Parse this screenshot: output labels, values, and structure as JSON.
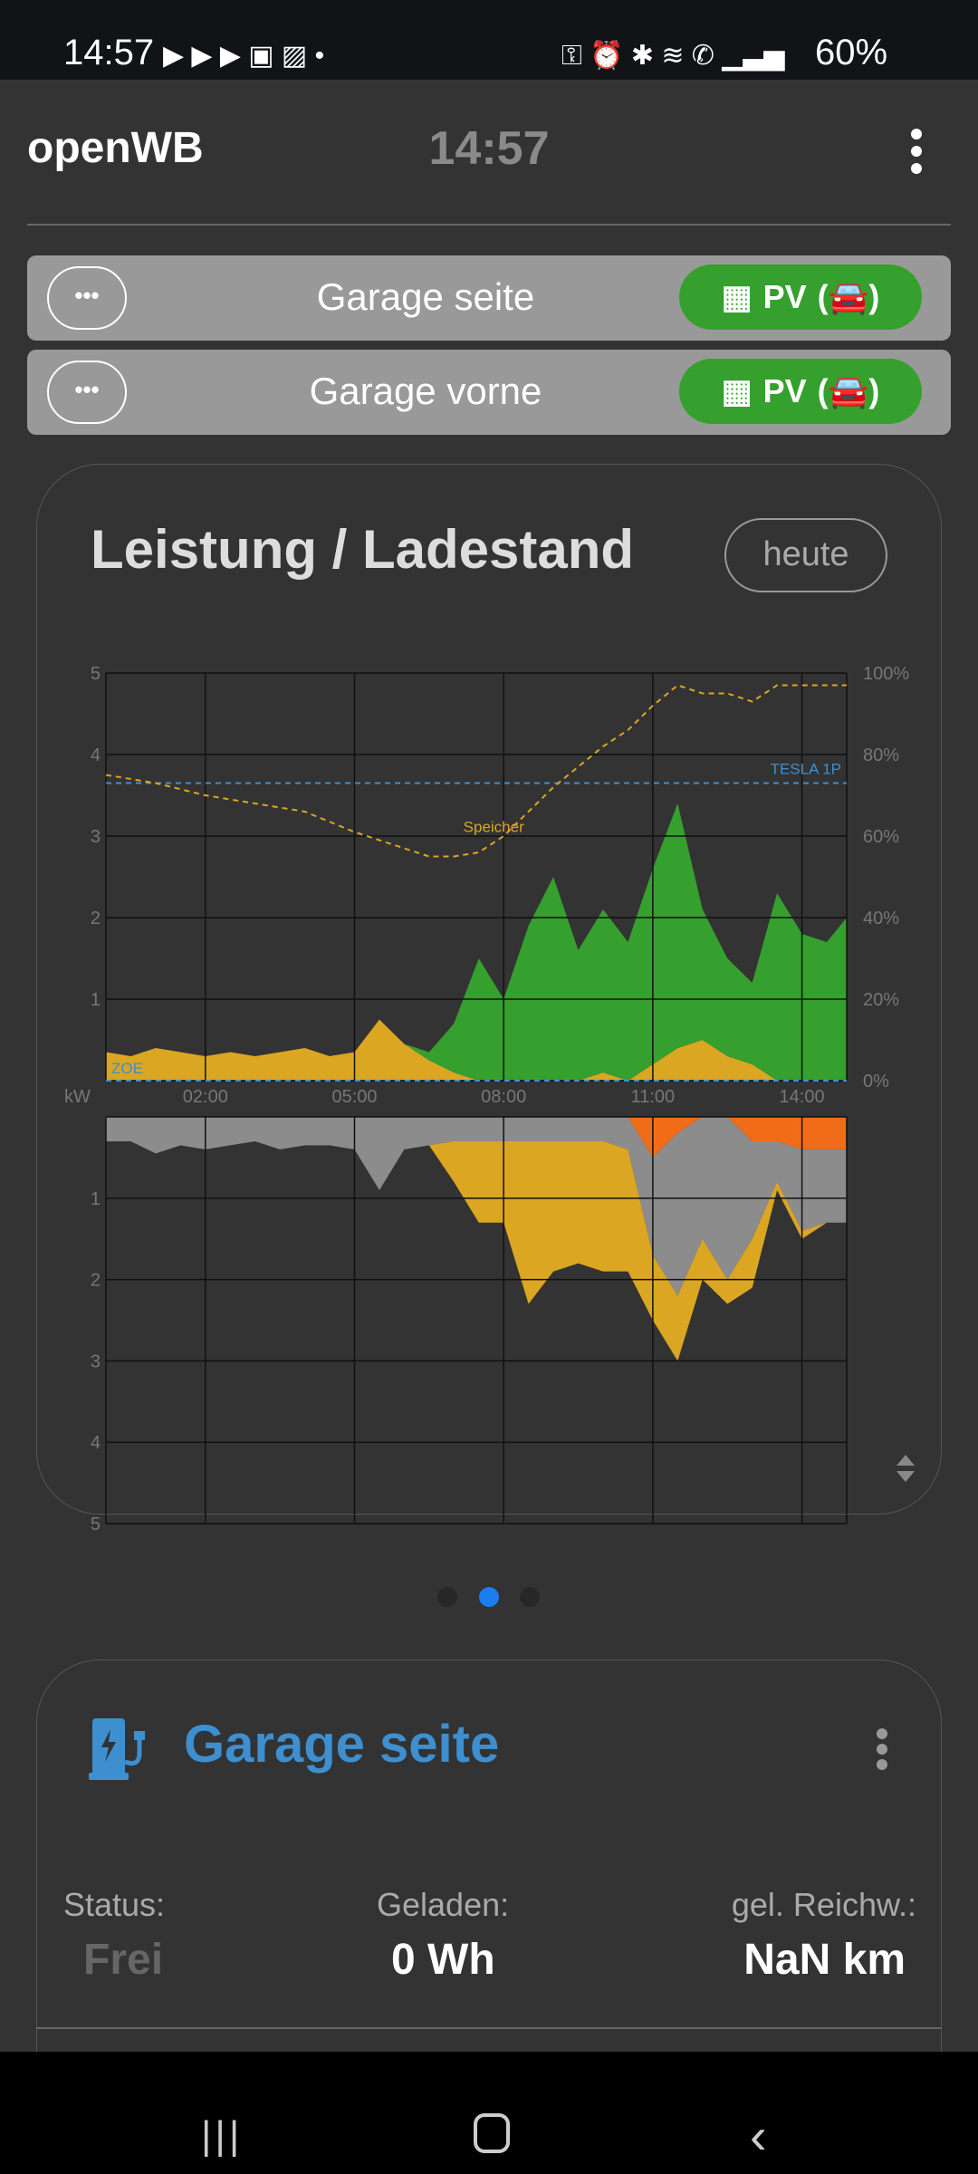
{
  "statusbar": {
    "time": "14:57",
    "battery": "60%"
  },
  "header": {
    "title": "openWB",
    "clock": "14:57"
  },
  "chargepoints": [
    {
      "name": "Garage seite",
      "mode": "PV",
      "more": "•••"
    },
    {
      "name": "Garage vorne",
      "mode": "PV",
      "more": "•••"
    }
  ],
  "chart_card": {
    "title": "Leistung / Ladestand",
    "range_button": "heute"
  },
  "chart_data": {
    "type": "area",
    "title": "Leistung / Ladestand",
    "xlabel": "",
    "ylabel": "kW",
    "x_ticks": [
      "02:00",
      "05:00",
      "08:00",
      "11:00",
      "14:00"
    ],
    "x_tick_values": [
      2,
      5,
      8,
      11,
      14
    ],
    "xlim": [
      0,
      14.9
    ],
    "ylim": [
      0,
      5
    ],
    "y_ticks": [
      "1",
      "2",
      "3",
      "4",
      "5"
    ],
    "y2_ticks": [
      "0%",
      "20%",
      "40%",
      "60%",
      "80%",
      "100%"
    ],
    "y2lim": [
      0,
      100
    ],
    "x": [
      0,
      0.5,
      1,
      1.5,
      2,
      2.5,
      3,
      3.5,
      4,
      4.5,
      5,
      5.5,
      6,
      6.5,
      7,
      7.5,
      8,
      8.5,
      9,
      9.5,
      10,
      10.5,
      11,
      11.5,
      12,
      12.5,
      13,
      13.5,
      14,
      14.5,
      14.9
    ],
    "upper_series": [
      {
        "color": "#dba622",
        "values": [
          0.35,
          0.3,
          0.4,
          0.35,
          0.3,
          0.35,
          0.3,
          0.35,
          0.4,
          0.3,
          0.35,
          0.75,
          0.45,
          0.25,
          0.1,
          0,
          0,
          0,
          0,
          0,
          0.1,
          0,
          0.2,
          0.4,
          0.5,
          0.3,
          0.2,
          0,
          0,
          0,
          0
        ]
      },
      {
        "color": "#35a02e",
        "values": [
          0,
          0,
          0,
          0,
          0,
          0,
          0,
          0,
          0,
          0,
          0,
          0,
          0,
          0.1,
          0.6,
          1.5,
          1.0,
          1.9,
          2.5,
          1.6,
          2.0,
          1.7,
          2.4,
          3.0,
          1.6,
          1.2,
          1.0,
          2.3,
          1.8,
          1.7,
          2.0
        ]
      }
    ],
    "lower_series": [
      {
        "color": "#f06c18",
        "values": [
          0,
          0,
          0,
          0,
          0,
          0,
          0,
          0,
          0,
          0,
          0,
          0,
          0,
          0,
          0,
          0,
          0,
          0,
          0,
          0,
          0,
          0,
          0.5,
          0.2,
          0,
          0,
          0.3,
          0.3,
          0.4,
          0.4,
          0.4
        ]
      },
      {
        "color": "#8c8c8c",
        "values": [
          0.3,
          0.3,
          0.45,
          0.35,
          0.4,
          0.35,
          0.3,
          0.4,
          0.35,
          0.35,
          0.4,
          0.9,
          0.4,
          0.35,
          0.3,
          0.3,
          0.3,
          0.3,
          0.3,
          0.3,
          0.3,
          0.4,
          1.2,
          2.0,
          1.5,
          2.0,
          1.2,
          0.5,
          1.0,
          0.9,
          0.9
        ]
      },
      {
        "color": "#dba622",
        "values": [
          0,
          0,
          0,
          0,
          0,
          0,
          0,
          0,
          0,
          0,
          0,
          0,
          0,
          0,
          0.5,
          1.0,
          1.0,
          2.0,
          1.6,
          1.5,
          1.6,
          1.5,
          0.8,
          0.8,
          0.5,
          0.3,
          0.6,
          0.1,
          0.1,
          0,
          0
        ]
      }
    ],
    "soc": {
      "label": "Speicher",
      "color": "#dba622",
      "x": [
        0,
        1,
        2,
        3,
        4,
        5,
        6,
        6.5,
        7,
        7.5,
        8,
        9,
        10,
        10.5,
        11,
        11.5,
        12,
        12.5,
        13,
        13.5,
        14,
        14.9
      ],
      "values": [
        75,
        73,
        70,
        68,
        66,
        61,
        57,
        55,
        55,
        56,
        60,
        72,
        82,
        86,
        92,
        97,
        95,
        95,
        93,
        97,
        97,
        97
      ]
    },
    "ref_lines": [
      {
        "label": "TESLA 1P",
        "value": 73,
        "color": "#3d8fd0"
      },
      {
        "label": "ZOE",
        "value": 0,
        "color": "#3d8fd0"
      }
    ]
  },
  "pager": {
    "count": 3,
    "active": 1
  },
  "chargepoint_card": {
    "title": "Garage seite",
    "status_label": "Status:",
    "status_value": "Frei",
    "charged_label": "Geladen:",
    "charged_value": "0 Wh",
    "range_label": "gel. Reichw.:",
    "range_value": "NaN km"
  }
}
